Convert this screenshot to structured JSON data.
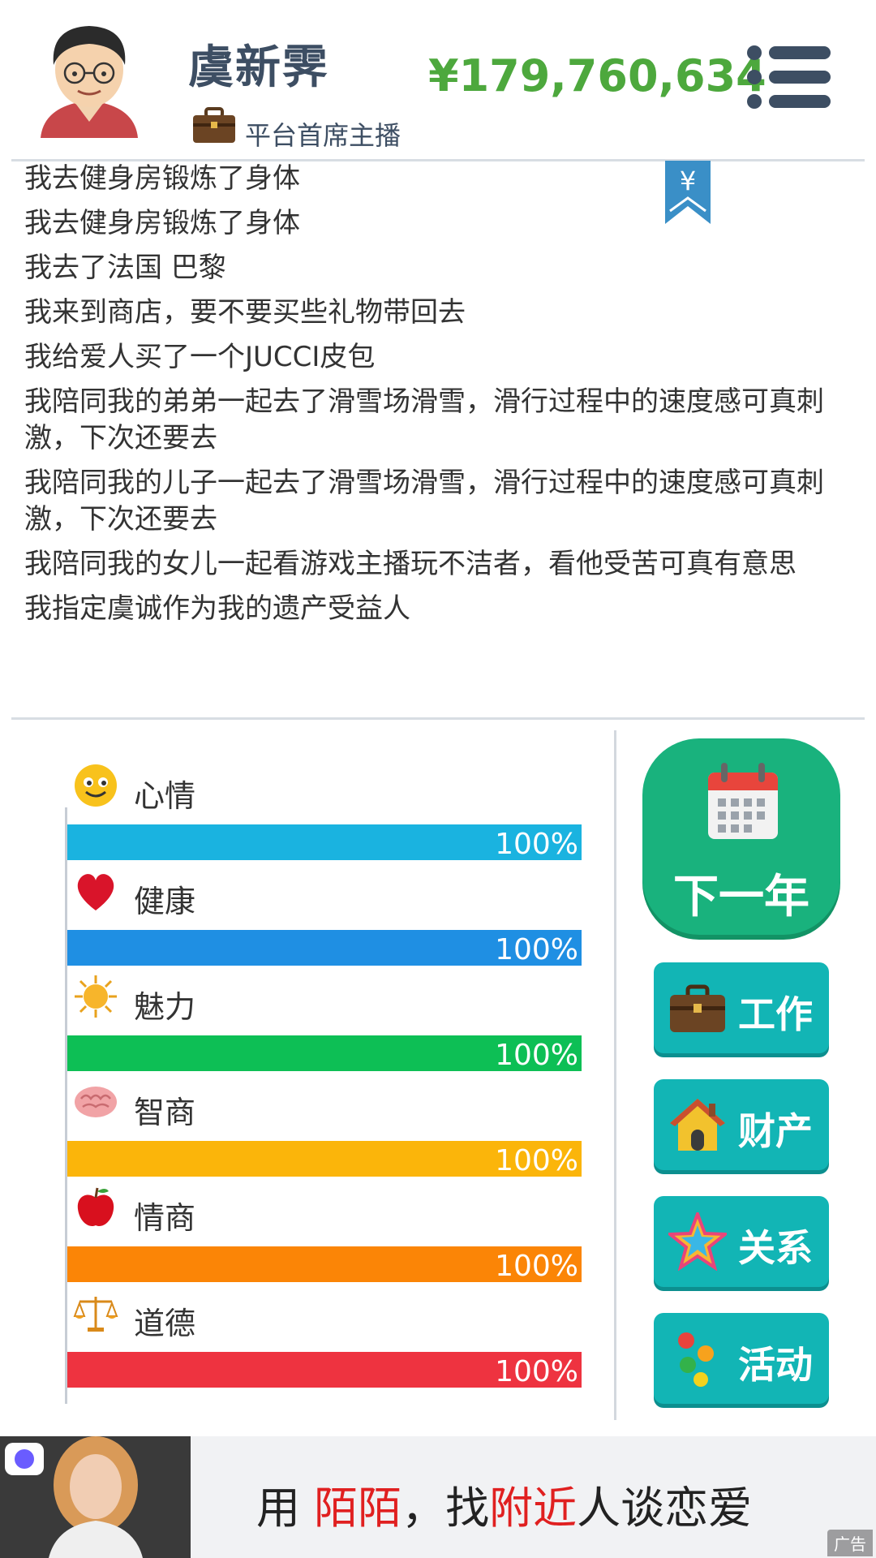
{
  "header": {
    "player_name": "虞新霁",
    "job_title": "平台首席主播",
    "money": "¥179,760,634",
    "icons": {
      "avatar": "player-avatar",
      "job": "briefcase-icon",
      "menu": "menu-icon"
    }
  },
  "log": {
    "bookmark_symbol": "¥",
    "lines": [
      "我去健身房锻炼了身体",
      "我去健身房锻炼了身体",
      "我去了法国 巴黎",
      "我来到商店，要不要买些礼物带回去",
      "我给爱人买了一个JUCCI皮包",
      "我陪同我的弟弟一起去了滑雪场滑雪，滑行过程中的速度感可真刺激，下次还要去",
      "我陪同我的儿子一起去了滑雪场滑雪，滑行过程中的速度感可真刺激，下次还要去",
      "我陪同我的女儿一起看游戏主播玩不洁者，看他受苦可真有意思",
      "我指定虞诚作为我的遗产受益人"
    ]
  },
  "stats": [
    {
      "label": "心情",
      "value_text": "100%",
      "fraction": 1.0,
      "color": "#1ab3e0",
      "icon": "smiley-icon"
    },
    {
      "label": "健康",
      "value_text": "100%",
      "fraction": 1.0,
      "color": "#1f8fe3",
      "icon": "heart-icon"
    },
    {
      "label": "魅力",
      "value_text": "100%",
      "fraction": 1.0,
      "color": "#0dbf55",
      "icon": "sun-icon"
    },
    {
      "label": "智商",
      "value_text": "100%",
      "fraction": 1.0,
      "color": "#fbb50a",
      "icon": "brain-icon"
    },
    {
      "label": "情商",
      "value_text": "100%",
      "fraction": 1.0,
      "color": "#fb8506",
      "icon": "apple-icon"
    },
    {
      "label": "道德",
      "value_text": "100%",
      "fraction": 1.0,
      "color": "#ee3340",
      "icon": "scales-icon"
    }
  ],
  "actions": {
    "next_year": "下一年",
    "work": "工作",
    "assets": "财产",
    "relations": "关系",
    "activities": "活动"
  },
  "ad": {
    "text_parts": [
      "用 ",
      "陌陌",
      "，找",
      "附近",
      "人谈恋爱"
    ],
    "tag": "广告"
  }
}
